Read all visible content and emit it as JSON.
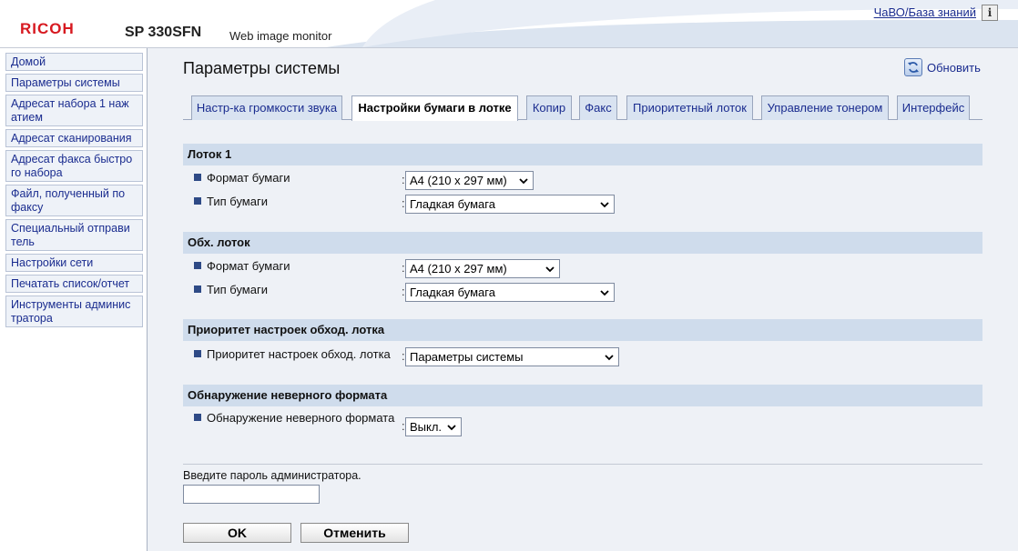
{
  "header": {
    "logo": "RICOH",
    "model": "SP 330SFN",
    "product": "Web image monitor",
    "faq_link": "ЧаВО/База знаний",
    "info_icon": "info-icon",
    "info_glyph": "i"
  },
  "sidebar": {
    "items": [
      {
        "label": "Домой"
      },
      {
        "label": "Параметры системы"
      },
      {
        "label": "Адресат набора 1 наж атием"
      },
      {
        "label": "Адресат сканирования"
      },
      {
        "label": "Адресат факса быстро го набора"
      },
      {
        "label": "Файл, полученный по факсу"
      },
      {
        "label": "Специальный отправи тель"
      },
      {
        "label": "Настройки сети"
      },
      {
        "label": "Печатать список/отчет"
      },
      {
        "label": "Инструменты админис тратора"
      }
    ]
  },
  "main": {
    "title": "Параметры системы",
    "refresh_label": "Обновить",
    "tabs": [
      {
        "label": "Настр-ка громкости звука",
        "active": false
      },
      {
        "label": "Настройки бумаги в лотке",
        "active": true
      },
      {
        "label": "Копир",
        "active": false
      },
      {
        "label": "Факс",
        "active": false
      },
      {
        "label": "Приоритетный лоток",
        "active": false
      },
      {
        "label": "Управление тонером",
        "active": false
      },
      {
        "label": "Интерфейс",
        "active": false
      }
    ],
    "sections": {
      "tray1": {
        "title": "Лоток 1",
        "paper_size_label": "Формат бумаги",
        "paper_size_value": "A4 (210 x 297 мм)",
        "paper_type_label": "Тип бумаги",
        "paper_type_value": "Гладкая бумага"
      },
      "bypass": {
        "title": "Обх. лоток",
        "paper_size_label": "Формат бумаги",
        "paper_size_value": "A4 (210 x 297 мм)",
        "paper_type_label": "Тип бумаги",
        "paper_type_value": "Гладкая бумага"
      },
      "bypass_priority": {
        "title": "Приоритет настроек обход. лотка",
        "label": "Приоритет настроек обход. лотка",
        "value": "Параметры системы"
      },
      "mismatch": {
        "title": "Обнаружение неверного формата",
        "label": "Обнаружение неверного формата",
        "value": "Выкл."
      }
    },
    "colon": ":",
    "password_label": "Введите пароль администратора.",
    "ok_label": "OK",
    "cancel_label": "Отменить"
  },
  "colors": {
    "brand_red": "#d71920",
    "link_blue": "#1a2c8f",
    "section_bg": "#cfdcec",
    "tab_bg": "#d9e3f1",
    "main_bg": "#eef1f6"
  }
}
